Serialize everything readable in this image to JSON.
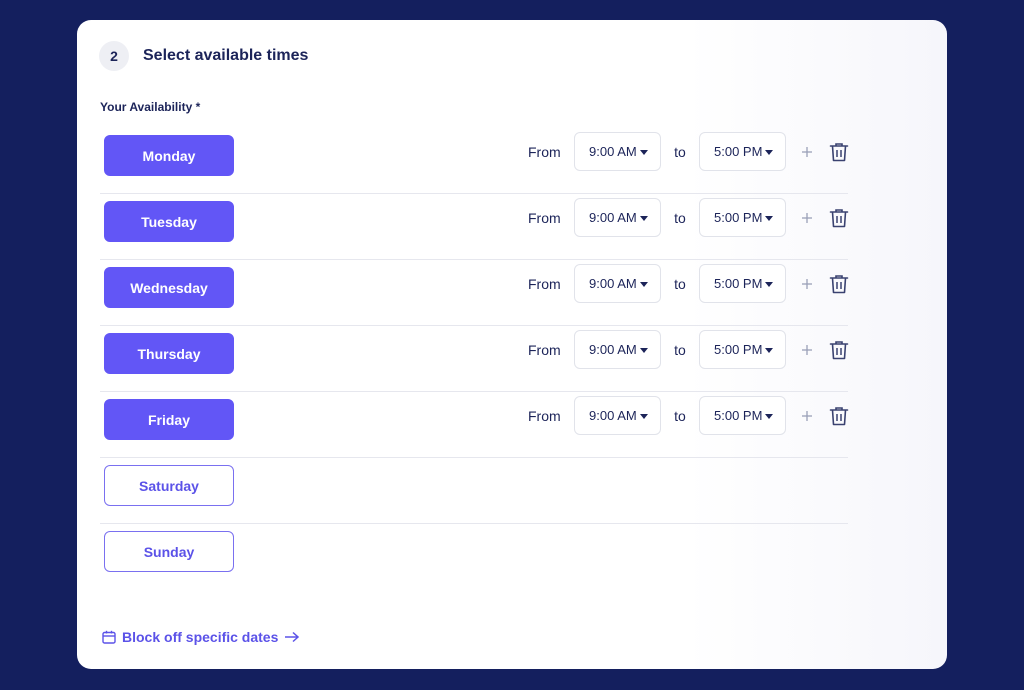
{
  "step": {
    "number": "2",
    "title": "Select available times"
  },
  "availability_label": "Your Availability *",
  "labels": {
    "from": "From",
    "to": "to"
  },
  "days": [
    {
      "name": "Monday",
      "active": true,
      "from": "9:00 AM",
      "to": "5:00 PM"
    },
    {
      "name": "Tuesday",
      "active": true,
      "from": "9:00 AM",
      "to": "5:00 PM"
    },
    {
      "name": "Wednesday",
      "active": true,
      "from": "9:00 AM",
      "to": "5:00 PM"
    },
    {
      "name": "Thursday",
      "active": true,
      "from": "9:00 AM",
      "to": "5:00 PM"
    },
    {
      "name": "Friday",
      "active": true,
      "from": "9:00 AM",
      "to": "5:00 PM"
    },
    {
      "name": "Saturday",
      "active": false
    },
    {
      "name": "Sunday",
      "active": false
    }
  ],
  "block_link": "Block off specific dates",
  "icons": {
    "add": "plus-icon",
    "delete": "trash-icon",
    "calendar": "calendar-icon",
    "arrow": "arrow-right-icon",
    "dropdown": "caret-down-icon"
  },
  "colors": {
    "background": "#141f5e",
    "accent": "#6256f6",
    "text": "#1c2459"
  }
}
